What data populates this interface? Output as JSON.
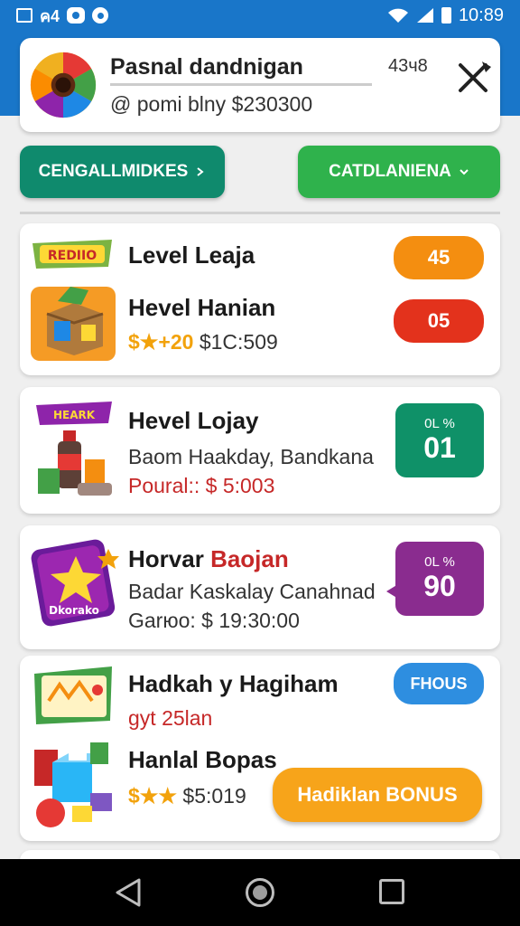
{
  "status_bar": {
    "left_text": "ค4",
    "time": "10:89"
  },
  "header": {
    "title": "Pasnal dandnigan",
    "subtitle": "@ pomi blny $230300",
    "count": "43ч8"
  },
  "tabs": [
    {
      "label": "CENGALLMIDKES"
    },
    {
      "label": "CATDLANIENA"
    }
  ],
  "cards": [
    {
      "thumb_label": "REDIIO",
      "title": "Level Leaja",
      "title2": "Hevel Hanian",
      "stars": "$★+20",
      "amount": "$1С:509",
      "badge1": "45",
      "badge2": "05"
    },
    {
      "thumb_label": "HEARK",
      "title": "Hevel Lojay",
      "subtitle": "Baom Haakday, Bandkana",
      "price_label": "Poural::",
      "price": "$ 5:003",
      "badge_top": "0L %",
      "badge_value": "01"
    },
    {
      "thumb_label": "Dkorako",
      "title_a": "Horvar",
      "title_b": "Baojan",
      "subtitle": "Badar Kaskalay Canahnad",
      "line3": "Garюo: $ 19:30:00",
      "badge_top": "0L %",
      "badge_value": "90"
    },
    {
      "title": "Hadkah y Hagiham",
      "subtitle": "gyt 25lan",
      "title2": "Hanlal Bopas",
      "stars": "$★★",
      "amount": "$5:019",
      "badge": "FHOUS",
      "button": "Hadiklan BONUS"
    }
  ],
  "colors": {
    "brand_blue": "#1976c9",
    "tab_teal": "#0f8a6d",
    "tab_green": "#2fb24c",
    "badge_orange": "#f48e10",
    "badge_red": "#e3321c",
    "badge_teal": "#0f9168",
    "badge_purple": "#8a2c8f",
    "badge_blue": "#2e8ee0",
    "bonus_orange": "#f7a41a"
  },
  "icons": [
    "square-icon",
    "chat-icon",
    "location-icon",
    "wifi-icon",
    "signal-icon",
    "battery-icon",
    "prize-wheel-icon",
    "close-tools-icon",
    "chevron-right-icon",
    "chevron-down-icon",
    "box-icon",
    "bottle-icon",
    "star-card-icon",
    "gift-blocks-icon",
    "back-icon",
    "home-icon",
    "recents-icon"
  ]
}
